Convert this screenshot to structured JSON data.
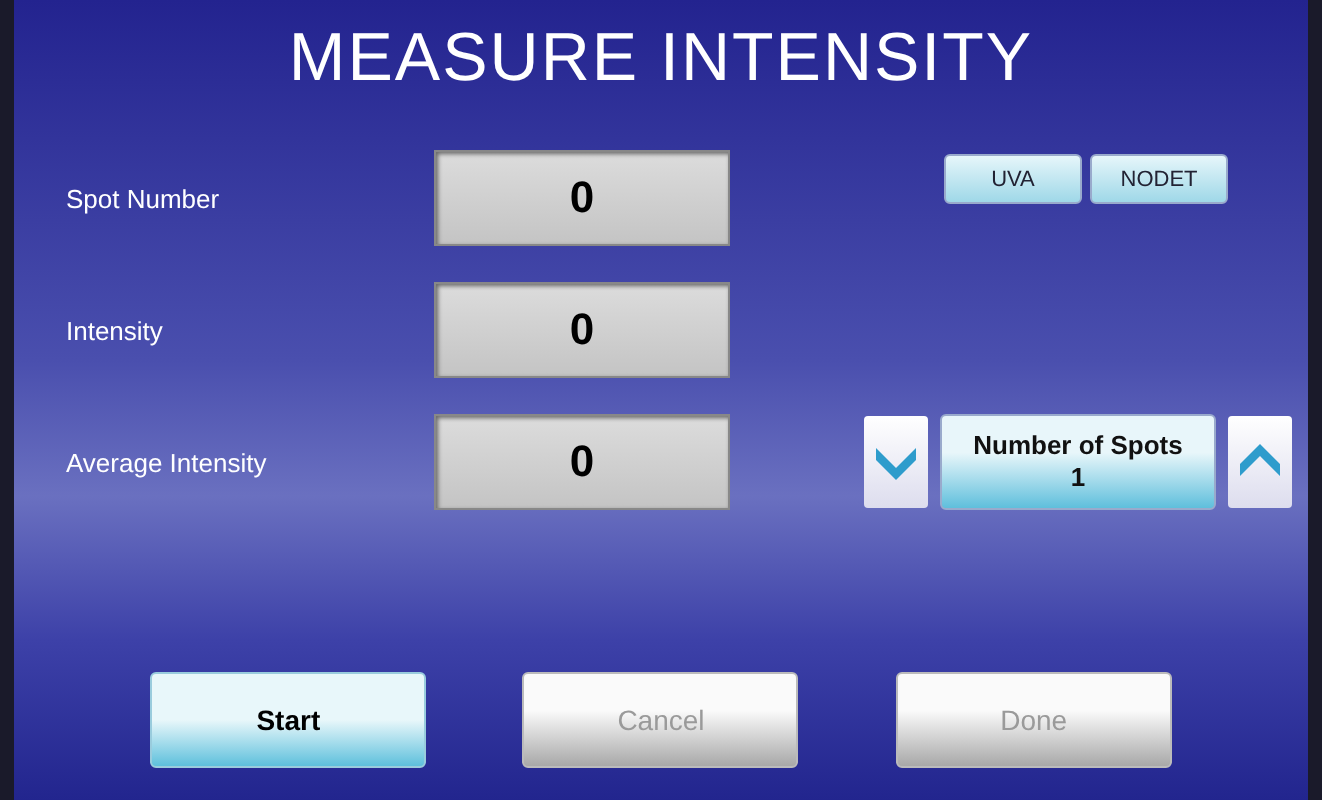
{
  "title": "MEASURE INTENSITY",
  "readouts": [
    {
      "label": "Spot Number",
      "value": "0"
    },
    {
      "label": "Intensity",
      "value": "0"
    },
    {
      "label": "Average Intensity",
      "value": "0"
    }
  ],
  "mode_buttons": [
    "UVA",
    "NODET"
  ],
  "spots_stepper": {
    "label": "Number of Spots",
    "value": "1"
  },
  "buttons": [
    {
      "label": "Start",
      "disabled": false
    },
    {
      "label": "Cancel",
      "disabled": true
    },
    {
      "label": "Done",
      "disabled": true
    }
  ]
}
